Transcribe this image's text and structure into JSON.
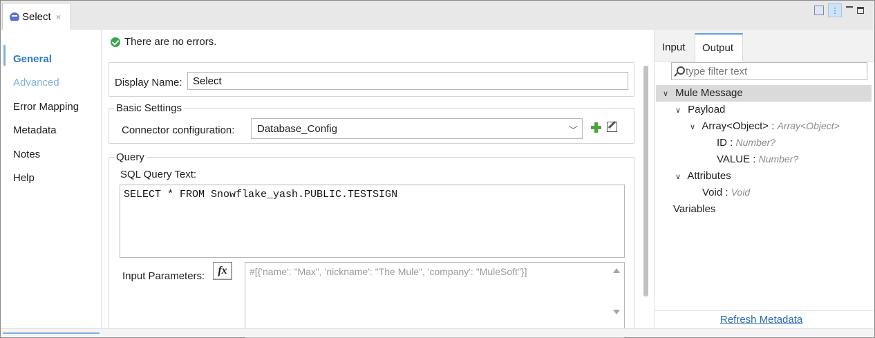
{
  "editor_tab": {
    "label": "Select",
    "close": "×"
  },
  "nav": {
    "items": [
      {
        "label": "General"
      },
      {
        "label": "Advanced"
      },
      {
        "label": "Error Mapping"
      },
      {
        "label": "Metadata"
      },
      {
        "label": "Notes"
      },
      {
        "label": "Help"
      }
    ]
  },
  "status": {
    "text": "There are no errors."
  },
  "display_name": {
    "label": "Display Name:",
    "value": "Select"
  },
  "basic_settings": {
    "title": "Basic Settings",
    "connector_label": "Connector configuration:",
    "connector_value": "Database_Config"
  },
  "query": {
    "title": "Query",
    "sql_label": "SQL Query Text:",
    "sql_value": "SELECT * FROM Snowflake_yash.PUBLIC.TESTSIGN",
    "input_params_label": "Input Parameters:",
    "fx_label": "fx",
    "input_params_placeholder": "#[{'name': \"Max\", 'nickname': \"The Mule\", 'company': \"MuleSoft\"}]"
  },
  "right_panel": {
    "tabs": [
      {
        "label": "Input"
      },
      {
        "label": "Output"
      }
    ],
    "filter_placeholder": "type filter text",
    "tree": {
      "mule_message": "Mule Message",
      "payload": "Payload",
      "array_name": "Array<Object>",
      "array_sep": " : ",
      "array_type": "Array<Object>",
      "id_name": "ID",
      "id_sep": " : ",
      "id_type": "Number?",
      "value_name": "VALUE",
      "value_sep": " : ",
      "value_type": "Number?",
      "attributes": "Attributes",
      "void_name": "Void",
      "void_sep": " : ",
      "void_type": "Void",
      "variables": "Variables"
    },
    "refresh_label": "Refresh Metadata"
  },
  "colors": {
    "accent": "#2e7bc4",
    "link": "#2b6cb5",
    "ok": "#3aa64a"
  }
}
